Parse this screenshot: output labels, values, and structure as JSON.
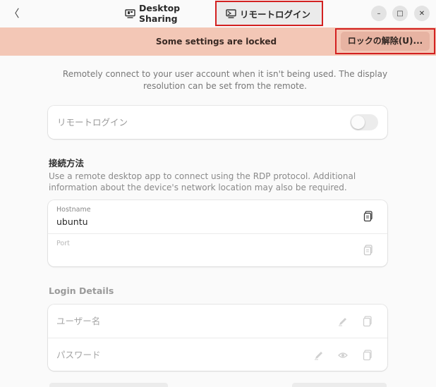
{
  "header": {
    "back_glyph": "〈",
    "tabs": [
      {
        "label": "Desktop Sharing",
        "icon": "desktop-sharing-icon",
        "selected": false
      },
      {
        "label": "リモートログイン",
        "icon": "remote-login-icon",
        "selected": true
      }
    ],
    "window_controls": {
      "minimize": "–",
      "maximize": "□",
      "close": "✕"
    }
  },
  "banner": {
    "message": "Some settings are locked",
    "unlock_label": "ロックの解除(U)...",
    "color": "#f3c7b6"
  },
  "description": "Remotely connect to your user account when it isn't being used. The display resolution can be set from the remote.",
  "remote_login": {
    "label": "リモートログイン",
    "enabled": false
  },
  "connection": {
    "title": "接続方法",
    "description": "Use a remote desktop app to connect using the RDP protocol. Additional information about the device's network location may also be required.",
    "fields": [
      {
        "caption": "Hostname",
        "value": "ubuntu",
        "icon": "copy-icon"
      },
      {
        "caption": "Port",
        "value": "",
        "icon": "copy-icon"
      }
    ]
  },
  "login_details": {
    "title": "Login Details",
    "username_label": "ユーザー名",
    "password_label": "パスワード"
  },
  "colors": {
    "highlight": "#d32121",
    "accent_banner": "#f3c7b6"
  }
}
